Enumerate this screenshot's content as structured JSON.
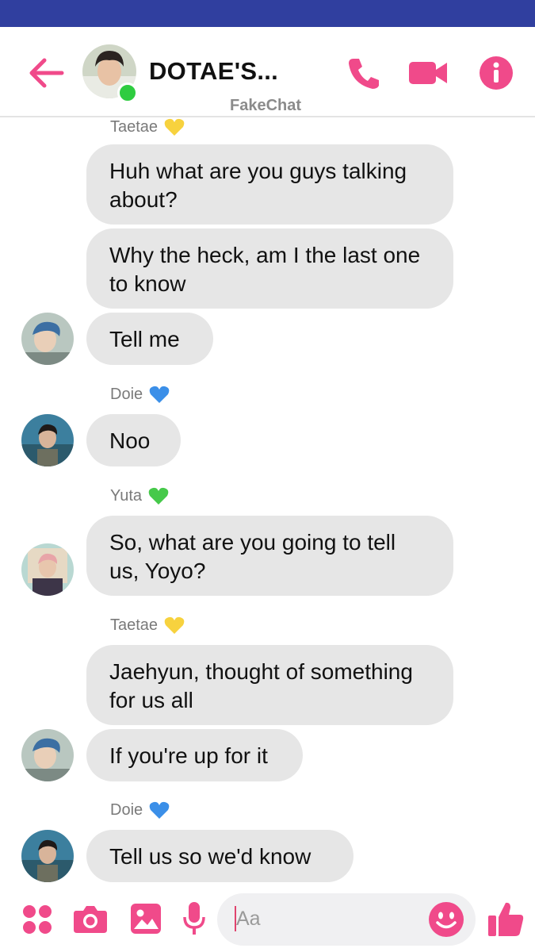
{
  "header": {
    "title": "DOTAE'S...",
    "subtitle": "FakeChat",
    "icons": [
      "back-arrow-icon",
      "phone-icon",
      "video-call-icon",
      "info-icon"
    ],
    "accent_color": "#f04a8a",
    "online_color": "#2ecc40",
    "statusbar_color": "#303f9f"
  },
  "messages": [
    {
      "sender": "Taetae",
      "heart": "yellow",
      "texts": [
        "Huh what are you guys talking about?",
        "Why the heck, am I the last one to know",
        "Tell me"
      ]
    },
    {
      "sender": "Doie",
      "heart": "blue",
      "texts": [
        "Noo"
      ]
    },
    {
      "sender": "Yuta",
      "heart": "green",
      "texts": [
        "So,  what are you going to tell us, Yoyo?"
      ]
    },
    {
      "sender": "Taetae",
      "heart": "yellow",
      "texts": [
        "Jaehyun, thought of something for us all",
        "If you're up for it"
      ]
    },
    {
      "sender": "Doie",
      "heart": "blue",
      "texts": [
        "Tell us so we'd know"
      ]
    }
  ],
  "composer": {
    "placeholder": "Aa",
    "icons": [
      "apps-icon",
      "camera-icon",
      "gallery-icon",
      "microphone-icon",
      "emoji-icon",
      "thumbs-up-icon"
    ]
  }
}
